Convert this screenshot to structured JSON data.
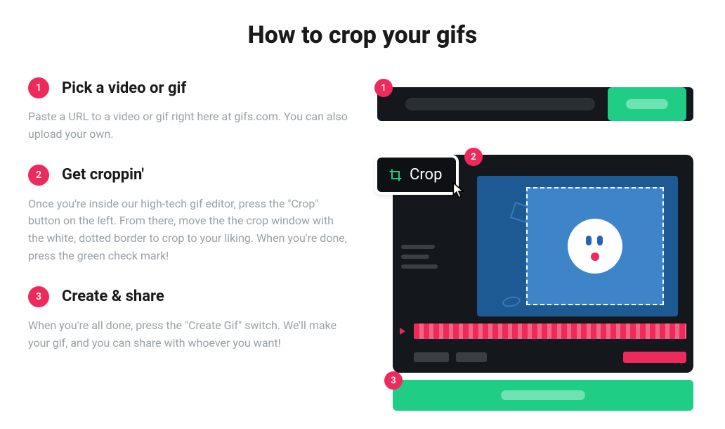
{
  "title": "How to crop your gifs",
  "steps": [
    {
      "num": "1",
      "title": "Pick a video or gif",
      "desc": "Paste a URL to a video or gif right here at gifs.com. You can also upload your own."
    },
    {
      "num": "2",
      "title": "Get croppin'",
      "desc": "Once you're inside our high-tech gif editor, press the \"Crop\" button on the left. From there, move the the crop window with the white, dotted border to crop to your liking. When you're done, press the green check mark!"
    },
    {
      "num": "3",
      "title": "Create & share",
      "desc": "When you're all done, press the \"Create Gif\" switch. We'll make your gif, and you can share with whoever you want!"
    }
  ],
  "illustration": {
    "crop_label": "Crop",
    "badge_1": "1",
    "badge_2": "2",
    "badge_3": "3"
  },
  "colors": {
    "accent_pink": "#ee2a5c",
    "accent_green": "#1fce84",
    "dark": "#14181c",
    "blue": "#1d5a93"
  }
}
